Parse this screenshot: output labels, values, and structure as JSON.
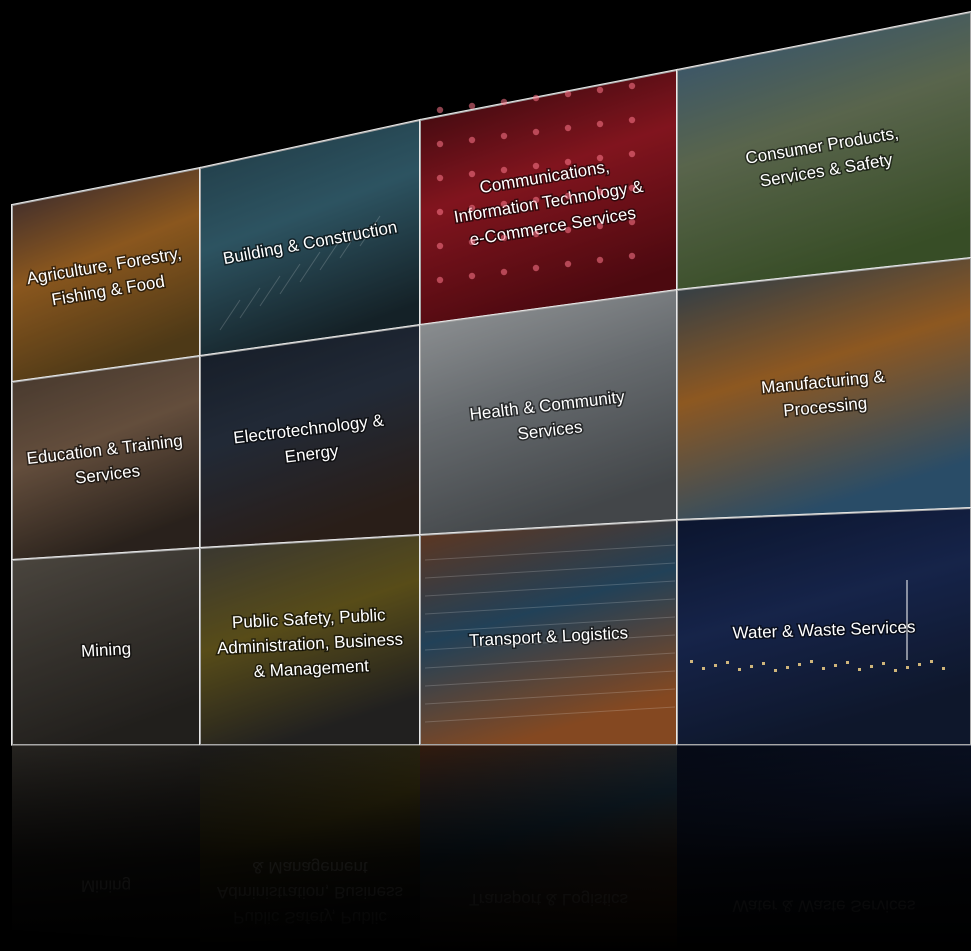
{
  "grid": {
    "tiles": [
      {
        "id": "agri",
        "lines": [
          "Agriculture, Forestry,",
          "Fishing & Food"
        ],
        "colors": [
          "#3b2f44",
          "#c0792a",
          "#6b4f20"
        ]
      },
      {
        "id": "building",
        "lines": [
          "Building & Construction"
        ],
        "colors": [
          "#2b4e5c",
          "#3f7487",
          "#1d2f37"
        ]
      },
      {
        "id": "comms",
        "lines": [
          "Communications,",
          "Information Technology &",
          "e-Commerce Services"
        ],
        "colors": [
          "#3d0a10",
          "#b31d2a",
          "#6a0d16"
        ]
      },
      {
        "id": "consumer",
        "lines": [
          "Consumer Products,",
          "Services & Safety"
        ],
        "colors": [
          "#3f6fa4",
          "#7c8c6a",
          "#4d6b35"
        ]
      },
      {
        "id": "education",
        "lines": [
          "Education & Training",
          "Services"
        ],
        "colors": [
          "#5c4a3c",
          "#8a6c54",
          "#3a2f27"
        ]
      },
      {
        "id": "electro",
        "lines": [
          "Electrotechnology &",
          "Energy"
        ],
        "colors": [
          "#1c2634",
          "#2f3a4c",
          "#3a2a22"
        ]
      },
      {
        "id": "health",
        "lines": [
          "Health & Community",
          "Services"
        ],
        "colors": [
          "#cfd3d6",
          "#8e9499",
          "#5d6266"
        ]
      },
      {
        "id": "manufacturing",
        "lines": [
          "Manufacturing &",
          "Processing"
        ],
        "colors": [
          "#2a4f6e",
          "#c47a2e",
          "#3a6a8f"
        ]
      },
      {
        "id": "mining",
        "lines": [
          "Mining"
        ],
        "colors": [
          "#6a6359",
          "#4b463f",
          "#2f2c28"
        ]
      },
      {
        "id": "public",
        "lines": [
          "Public Safety, Public",
          "Administration, Business",
          "& Management"
        ],
        "colors": [
          "#4c4a48",
          "#7a6a22",
          "#2e2d2c"
        ]
      },
      {
        "id": "transport",
        "lines": [
          "Transport & Logistics"
        ],
        "colors": [
          "#8a4a26",
          "#2f5a7a",
          "#b8652e"
        ]
      },
      {
        "id": "water",
        "lines": [
          "Water & Waste Services"
        ],
        "colors": [
          "#0f1c3d",
          "#1f3266",
          "#14203c"
        ]
      }
    ]
  }
}
